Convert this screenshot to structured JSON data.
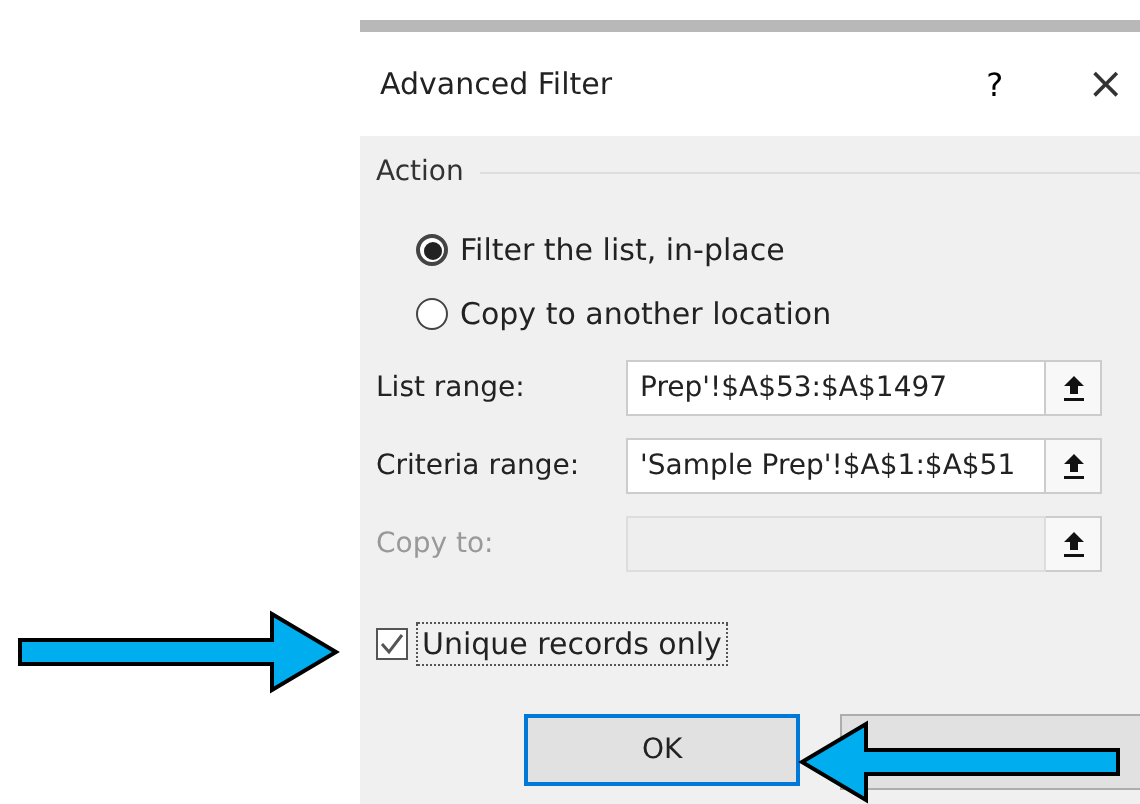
{
  "window": {
    "title": "Advanced Filter",
    "help": "?",
    "close": "×"
  },
  "action": {
    "label": "Action",
    "options": [
      {
        "label": "Filter the list, in-place",
        "selected": true
      },
      {
        "label": "Copy to another location",
        "selected": false
      }
    ]
  },
  "fields": [
    {
      "label": "List range:",
      "value": "Prep'!$A$53:$A$1497",
      "disabled": false
    },
    {
      "label": "Criteria range:",
      "value": "'Sample Prep'!$A$1:$A$51",
      "disabled": false
    },
    {
      "label": "Copy to:",
      "disabled": true
    }
  ],
  "unique": {
    "label": "Unique records only",
    "checked": true
  },
  "buttons": [
    "OK"
  ]
}
